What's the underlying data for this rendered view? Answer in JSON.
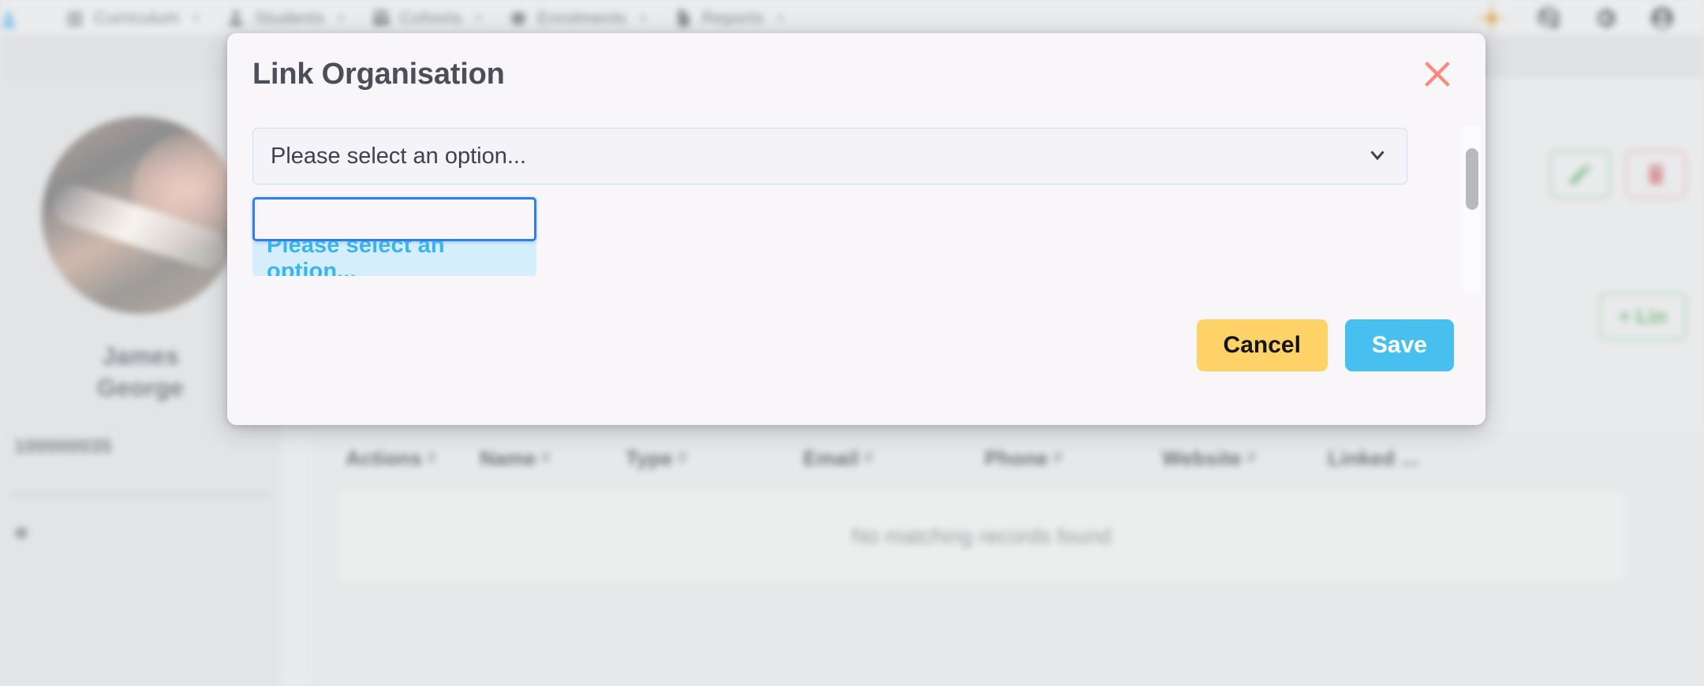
{
  "topnav": {
    "brand": "logo-triangle",
    "items": [
      {
        "label": "Curriculum",
        "icon": "list-icon",
        "caret": "▾"
      },
      {
        "label": "Students",
        "icon": "person-icon",
        "caret": "▾"
      },
      {
        "label": "Cohorts",
        "icon": "group-icon",
        "caret": "▾"
      },
      {
        "label": "Enrolments",
        "icon": "graduation-cap-icon",
        "caret": "▾"
      },
      {
        "label": "Reports",
        "icon": "document-icon",
        "caret": "▾"
      }
    ],
    "right_icons": [
      "sun-icon",
      "globe-icon",
      "gear-icon",
      "account-circle-icon"
    ]
  },
  "left_panel": {
    "avatar_alt": "student-photo",
    "name_line1": "James",
    "name_line2": "George",
    "student_id": "100000035"
  },
  "content": {
    "edit_button": "edit-pencil",
    "delete_button": "trash",
    "link_button_label": "+ Lin",
    "table": {
      "columns": [
        "Actions",
        "Name",
        "Type",
        "Email",
        "Phone",
        "Website",
        "Linked ..."
      ],
      "empty_message": "No matching records found",
      "rows": []
    }
  },
  "modal": {
    "title": "Link Organisation",
    "close_icon": "close-x-icon",
    "select": {
      "value": "Please select an option...",
      "chevron": "chevron-down-icon"
    },
    "dropdown": {
      "search_value": "",
      "search_placeholder": "",
      "options": [
        {
          "label": "Please select an option...",
          "highlighted": true
        }
      ]
    },
    "buttons": {
      "cancel": "Cancel",
      "save": "Save"
    }
  },
  "colors": {
    "accent_blue": "#47c0f0",
    "option_text": "#3bb4ef",
    "option_bg": "#d4eefb",
    "cancel_yellow": "#ffd267",
    "close_red": "#f98a7f",
    "focus_blue": "#2f7ef0",
    "modal_bg": "#f8f6f9"
  }
}
